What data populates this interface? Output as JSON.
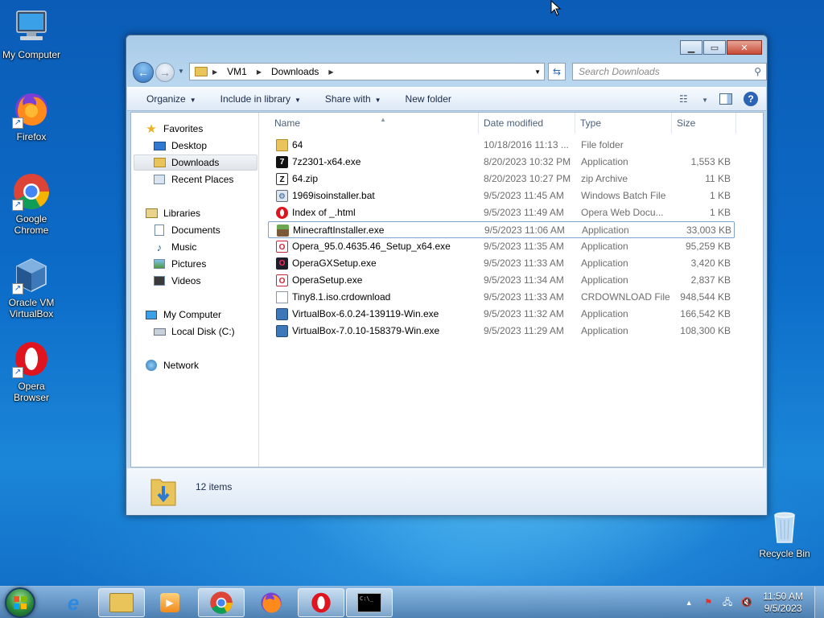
{
  "desktop": {
    "icons": [
      {
        "label": "My Computer"
      },
      {
        "label": "Firefox"
      },
      {
        "label": "Google Chrome"
      },
      {
        "label": "Oracle VM VirtualBox"
      },
      {
        "label": "Opera Browser"
      },
      {
        "label": "Recycle Bin"
      }
    ]
  },
  "window": {
    "address": {
      "crumbs": [
        "VM1",
        "Downloads"
      ]
    },
    "search_placeholder": "Search Downloads",
    "toolbar": {
      "organize": "Organize",
      "include_in_library": "Include in library",
      "share_with": "Share with",
      "new_folder": "New folder"
    },
    "sidebar": {
      "favorites": "Favorites",
      "desktop": "Desktop",
      "downloads": "Downloads",
      "recent_places": "Recent Places",
      "libraries": "Libraries",
      "documents": "Documents",
      "music": "Music",
      "pictures": "Pictures",
      "videos": "Videos",
      "my_computer": "My Computer",
      "local_disk": "Local Disk (C:)",
      "network": "Network"
    },
    "columns": {
      "name": "Name",
      "date": "Date modified",
      "type": "Type",
      "size": "Size"
    },
    "files": [
      {
        "name": "64",
        "date": "10/18/2016 11:13 ...",
        "type": "File folder",
        "size": "",
        "icon": "folder-icon"
      },
      {
        "name": "7z2301-x64.exe",
        "date": "8/20/2023 10:32 PM",
        "type": "Application",
        "size": "1,553 KB",
        "icon": "7zip-icon"
      },
      {
        "name": "64.zip",
        "date": "8/20/2023 10:27 PM",
        "type": "zip Archive",
        "size": "11 KB",
        "icon": "zip-icon"
      },
      {
        "name": "1969isoinstaller.bat",
        "date": "9/5/2023 11:45 AM",
        "type": "Windows Batch File",
        "size": "1 KB",
        "icon": "batch-file-icon"
      },
      {
        "name": "Index of _.html",
        "date": "9/5/2023 11:49 AM",
        "type": "Opera Web Docu...",
        "size": "1 KB",
        "icon": "opera-icon"
      },
      {
        "name": "MinecraftInstaller.exe",
        "date": "9/5/2023 11:06 AM",
        "type": "Application",
        "size": "33,003 KB",
        "icon": "minecraft-icon"
      },
      {
        "name": "Opera_95.0.4635.46_Setup_x64.exe",
        "date": "9/5/2023 11:35 AM",
        "type": "Application",
        "size": "95,259 KB",
        "icon": "opera-setup-icon"
      },
      {
        "name": "OperaGXSetup.exe",
        "date": "9/5/2023 11:33 AM",
        "type": "Application",
        "size": "3,420 KB",
        "icon": "opera-gx-icon"
      },
      {
        "name": "OperaSetup.exe",
        "date": "9/5/2023 11:34 AM",
        "type": "Application",
        "size": "2,837 KB",
        "icon": "opera-setup-icon"
      },
      {
        "name": "Tiny8.1.iso.crdownload",
        "date": "9/5/2023 11:33 AM",
        "type": "CRDOWNLOAD File",
        "size": "948,544 KB",
        "icon": "file-icon"
      },
      {
        "name": "VirtualBox-6.0.24-139119-Win.exe",
        "date": "9/5/2023 11:32 AM",
        "type": "Application",
        "size": "166,542 KB",
        "icon": "virtualbox-icon"
      },
      {
        "name": "VirtualBox-7.0.10-158379-Win.exe",
        "date": "9/5/2023 11:29 AM",
        "type": "Application",
        "size": "108,300 KB",
        "icon": "virtualbox-icon"
      }
    ],
    "status": {
      "count": "12 items"
    }
  },
  "taskbar": {
    "clock_time": "11:50 AM",
    "clock_date": "9/5/2023"
  }
}
